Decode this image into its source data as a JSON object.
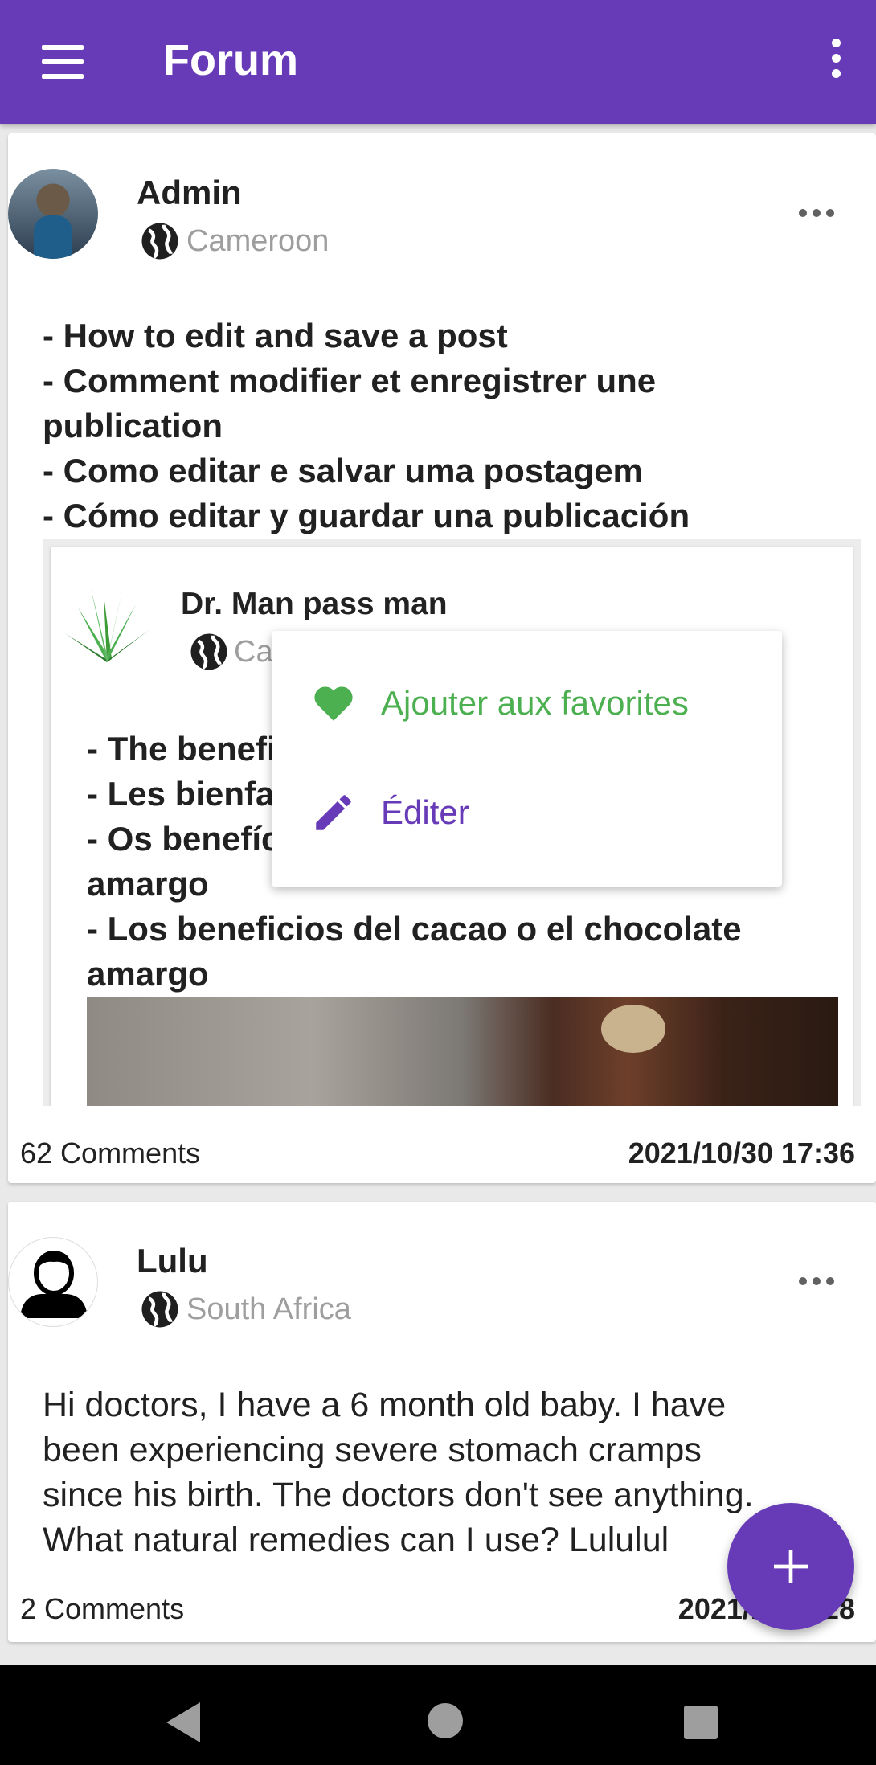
{
  "appbar": {
    "title": "Forum",
    "menu_icon": "hamburger-menu-icon",
    "more_icon": "overflow-menu-icon",
    "color": "#673ab7"
  },
  "posts": [
    {
      "author": "Admin",
      "country": "Cameroon",
      "lines": [
        "- How to edit and save a post",
        "- Comment modifier et enregistrer une",
        "publication",
        "- Como editar e salvar uma postagem",
        "- Cómo editar y guardar una publicación"
      ],
      "embedded": {
        "author": "Dr. Man pass man",
        "country": "Camero",
        "lines": [
          "- The benefits",
          "- Les bienfaits",
          "- Os benefícios",
          "amargo",
          "- Los beneficios del cacao o el chocolate",
          "amargo"
        ],
        "menu": {
          "favorite": "Ajouter aux favorites",
          "edit": "Éditer"
        }
      },
      "comments": "62 Comments",
      "date": "2021/10/30 17:36"
    },
    {
      "author": "Lulu",
      "country": "South Africa",
      "lines": [
        "Hi doctors, I have a 6 month old baby. I have",
        "been experiencing severe stomach cramps",
        "since his birth. The doctors don't see anything.",
        "What natural remedies can I use? Lululul"
      ],
      "comments": "2 Comments",
      "date": "2021/10/2 .28"
    }
  ],
  "fab": {
    "icon": "plus-icon"
  },
  "navbar": {
    "back_icon": "back-icon",
    "home_icon": "home-icon",
    "recent_icon": "recent-apps-icon"
  }
}
